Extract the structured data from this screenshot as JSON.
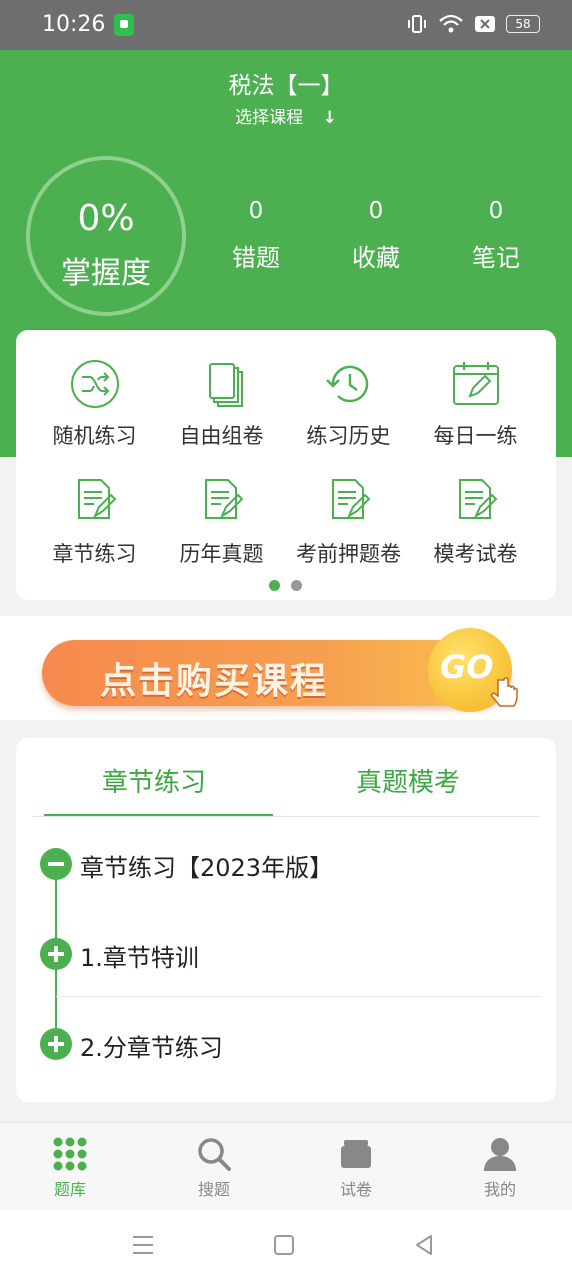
{
  "status_bar": {
    "time": "10:26",
    "battery": "58"
  },
  "header": {
    "title": "税法【一】",
    "subtitle": "选择课程",
    "subtitle_arrow": "↓"
  },
  "mastery": {
    "percent": "0%",
    "label": "掌握度"
  },
  "stats": [
    {
      "value": "0",
      "label": "错题"
    },
    {
      "value": "0",
      "label": "收藏"
    },
    {
      "value": "0",
      "label": "笔记"
    }
  ],
  "grid": [
    {
      "label": "随机练习",
      "icon": "shuffle-icon"
    },
    {
      "label": "自由组卷",
      "icon": "papers-icon"
    },
    {
      "label": "练习历史",
      "icon": "history-icon"
    },
    {
      "label": "每日一练",
      "icon": "calendar-edit-icon"
    },
    {
      "label": "章节练习",
      "icon": "document-edit-icon"
    },
    {
      "label": "历年真题",
      "icon": "document-edit-icon"
    },
    {
      "label": "考前押题卷",
      "icon": "document-edit-icon"
    },
    {
      "label": "模考试卷",
      "icon": "document-edit-icon"
    }
  ],
  "pager": {
    "pages": 2,
    "active": 1,
    "active_color": "#4caf50",
    "inactive_color": "#999999"
  },
  "banner": {
    "text": "点击购买课程",
    "go": "GO"
  },
  "tabs": [
    {
      "label": "章节练习",
      "active": true
    },
    {
      "label": "真题模考",
      "active": false
    }
  ],
  "chapters": {
    "group_title": "章节练习【2023年版】",
    "items": [
      "1.章节特训",
      "2.分章节练习"
    ]
  },
  "bottom_nav": [
    {
      "label": "题库",
      "icon": "grid-icon",
      "active": true
    },
    {
      "label": "搜题",
      "icon": "search-icon",
      "active": false
    },
    {
      "label": "试卷",
      "icon": "papers-stack-icon",
      "active": false
    },
    {
      "label": "我的",
      "icon": "user-icon",
      "active": false
    }
  ],
  "colors": {
    "primary": "#4caf50",
    "banner_orange": "#f7894e"
  }
}
